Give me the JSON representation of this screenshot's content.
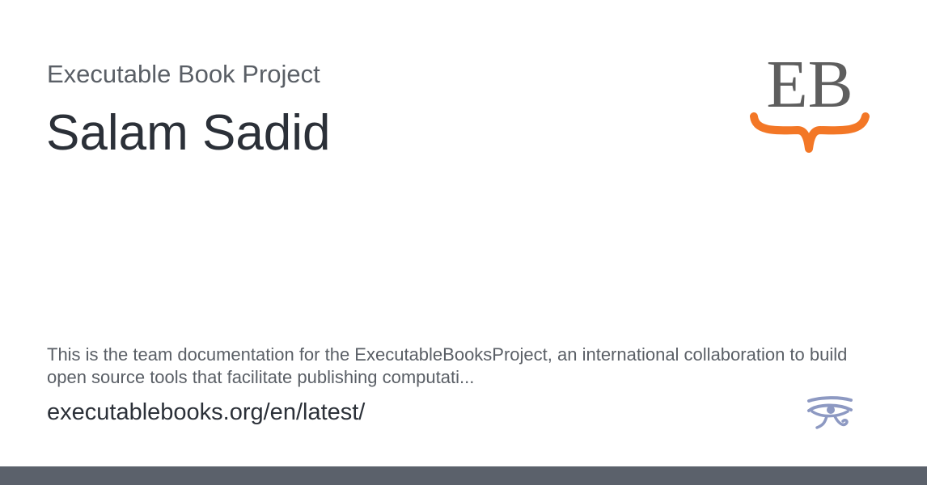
{
  "card": {
    "site_name": "Executable Book Project",
    "title": "Salam Sadid",
    "description": "This is the team documentation for the ExecutableBooksProject, an international collaboration to build open source tools that facilitate publishing computati...",
    "url": "executablebooks.org/en/latest/"
  },
  "logo": {
    "text": "EB",
    "icon": "executable-books-logo",
    "text_color": "#5e5e5e",
    "brace_color": "#f37726"
  },
  "eye": {
    "icon": "eye-of-horus-icon",
    "color": "#8d99c2"
  },
  "colors": {
    "title": "#2b3038",
    "muted": "#5a5f66",
    "bottom_bar": "#5b616b",
    "background": "#ffffff"
  }
}
